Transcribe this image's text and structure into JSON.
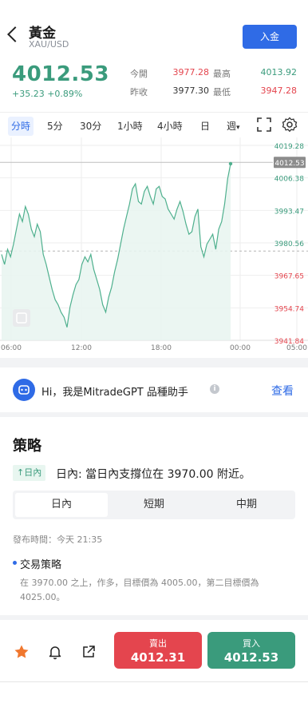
{
  "header": {
    "title": "黃金",
    "symbol": "XAU/USD",
    "deposit_label": "入金"
  },
  "quote": {
    "price": "4012.53",
    "change": "+35.23 +0.89%",
    "open_label": "今開",
    "open_value": "3977.28",
    "high_label": "最高",
    "high_value": "4013.92",
    "prev_close_label": "昨收",
    "prev_close_value": "3977.30",
    "low_label": "最低",
    "low_value": "3947.28"
  },
  "timeframes": {
    "items": [
      "分時",
      "5分",
      "30分",
      "1小時",
      "4小時",
      "日",
      "週"
    ],
    "active": "分時"
  },
  "chart_data": {
    "type": "area",
    "x_ticks": [
      "06:00",
      "12:00",
      "18:00",
      "00:00",
      "05:00"
    ],
    "y_ticks": [
      4019.28,
      4006.38,
      3993.47,
      3980.56,
      3967.65,
      3954.74,
      3941.84
    ],
    "ylim": [
      3941.84,
      4019.28
    ],
    "current_price": 4012.53,
    "prev_close": 3977.3,
    "colors": {
      "line": "#4fb08e",
      "up_tick": "#3a9b7c",
      "down_tick": "#e4454e"
    },
    "series": [
      {
        "values": [
          3976,
          3972,
          3978,
          3975,
          3980,
          3986,
          3992,
          3989,
          3995,
          3992,
          3986,
          3983,
          3988,
          3985,
          3976,
          3972,
          3967,
          3962,
          3958,
          3956,
          3953,
          3951,
          3947,
          3955,
          3960,
          3964,
          3966,
          3972,
          3975,
          3973,
          3976,
          3970,
          3966,
          3962,
          3956,
          3953,
          3959,
          3963,
          3969,
          3974,
          3980,
          3986,
          3991,
          3996,
          4002,
          4004,
          3997,
          3996,
          4001,
          4003,
          3999,
          3996,
          4002,
          4003,
          3999,
          3998,
          3994,
          3992,
          3990,
          3994,
          3997,
          3993,
          3988,
          3984,
          3985,
          3991,
          3994,
          3979,
          3975,
          3980,
          3982,
          3984,
          3978,
          3986,
          3989,
          3996,
          4006,
          4012
        ]
      }
    ]
  },
  "gpt_banner": {
    "text": "Hi，我是MitradeGPT 品種助手",
    "link": "查看"
  },
  "strategy": {
    "title": "策略",
    "badge": "↑日內",
    "headline": "日內: 當日內支撐位在 3970.00 附近。",
    "segments": [
      "日內",
      "短期",
      "中期"
    ],
    "active_segment": "日內",
    "published": "發布時間：今天 21:35",
    "section_title": "交易策略",
    "body": "在 3970.00 之上，作多，目標價為 4005.00，第二目標價為 4025.00。"
  },
  "footer": {
    "sell_label": "賣出",
    "sell_price": "4012.31",
    "buy_label": "買入",
    "buy_price": "4012.53"
  }
}
